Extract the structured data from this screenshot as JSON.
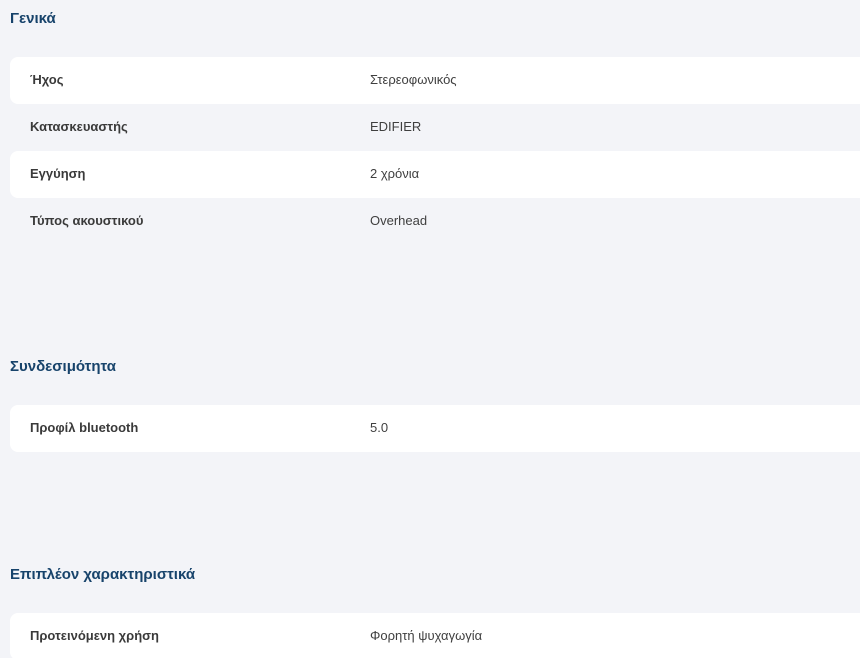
{
  "sections": [
    {
      "title": "Γενικά",
      "rows": [
        {
          "label": "Ήχος",
          "value": "Στερεοφωνικός"
        },
        {
          "label": "Κατασκευαστής",
          "value": "EDIFIER"
        },
        {
          "label": "Εγγύηση",
          "value": "2 χρόνια"
        },
        {
          "label": "Τύπος ακουστικού",
          "value": "Overhead"
        }
      ]
    },
    {
      "title": "Συνδεσιμότητα",
      "rows": [
        {
          "label": "Προφίλ bluetooth",
          "value": "5.0"
        }
      ]
    },
    {
      "title": "Επιπλέον χαρακτηριστικά",
      "rows": [
        {
          "label": "Προτεινόμενη χρήση",
          "value": "Φορητή ψυχαγωγία"
        }
      ]
    }
  ]
}
